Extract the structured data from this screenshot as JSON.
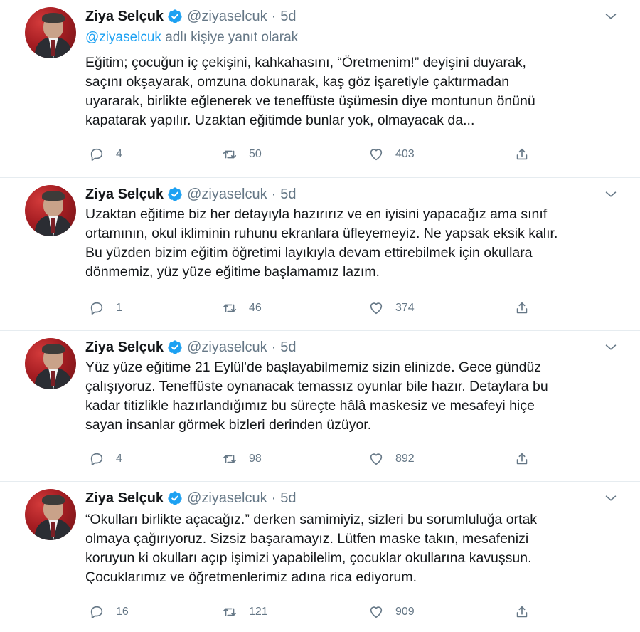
{
  "colors": {
    "accent": "#1da1f2",
    "secondary_text": "#657786",
    "primary_text": "#14171a",
    "divider": "#e6ecf0"
  },
  "icons": {
    "verified": "verified-badge-icon",
    "caret": "chevron-down-icon",
    "reply": "reply-icon",
    "retweet": "retweet-icon",
    "like": "heart-icon",
    "share": "share-icon"
  },
  "tweets": [
    {
      "name": "Ziya Selçuk",
      "handle": "@ziyaselcuk",
      "time": "5d",
      "reply_mention": "@ziyaselcuk",
      "reply_suffix": " adlı kişiye yanıt olarak",
      "lines": [
        "Eğitim; çocuğun iç çekişini, kahkahasını, “Öretmenim!” deyişini duyarak,",
        "saçını okşayarak, omzuna dokunarak, kaş göz işaretiyle çaktırmadan",
        "uyararak, birlikte eğlenerek ve teneffüste üşümesin diye montunun önünü",
        "kapatarak yapılır. Uzaktan eğitimde bunlar yok, olmayacak da..."
      ],
      "replies": "4",
      "retweets": "50",
      "likes": "403"
    },
    {
      "name": "Ziya Selçuk",
      "handle": "@ziyaselcuk",
      "time": "5d",
      "lines": [
        "Uzaktan eğitime biz her detayıyla hazırırız ve en iyisini yapacağız ama sınıf",
        "ortamının, okul ikliminin ruhunu ekranlara üfleyemeyiz. Ne yapsak eksik kalır.",
        "Bu yüzden bizim eğitim öğretimi layıkıyla devam ettirebilmek için okullara",
        "dönmemiz, yüz yüze eğitime başlamamız lazım."
      ],
      "replies": "1",
      "retweets": "46",
      "likes": "374"
    },
    {
      "name": "Ziya Selçuk",
      "handle": "@ziyaselcuk",
      "time": "5d",
      "lines": [
        "Yüz yüze eğitime 21 Eylül'de başlayabilmemiz sizin elinizde. Gece gündüz",
        "çalışıyoruz. Teneffüste oynanacak temassız oyunlar bile hazır. Detaylara bu",
        "kadar titizlikle hazırlandığımız bu süreçte hâlâ maskesiz ve mesafeyi hiçe",
        "sayan insanlar görmek bizleri derinden üzüyor."
      ],
      "replies": "4",
      "retweets": "98",
      "likes": "892"
    },
    {
      "name": "Ziya Selçuk",
      "handle": "@ziyaselcuk",
      "time": "5d",
      "lines": [
        "“Okulları birlikte açacağız.” derken samimiyiz, sizleri bu sorumluluğa ortak",
        "olmaya çağırıyoruz. Sizsiz başaramayız. Lütfen maske takın, mesafenizi",
        "koruyun ki okulları açıp işimizi yapabilelim, çocuklar okullarına kavuşsun.",
        "Çocuklarımız ve öğretmenlerimiz adına rica ediyorum."
      ],
      "replies": "16",
      "retweets": "121",
      "likes": "909"
    }
  ]
}
